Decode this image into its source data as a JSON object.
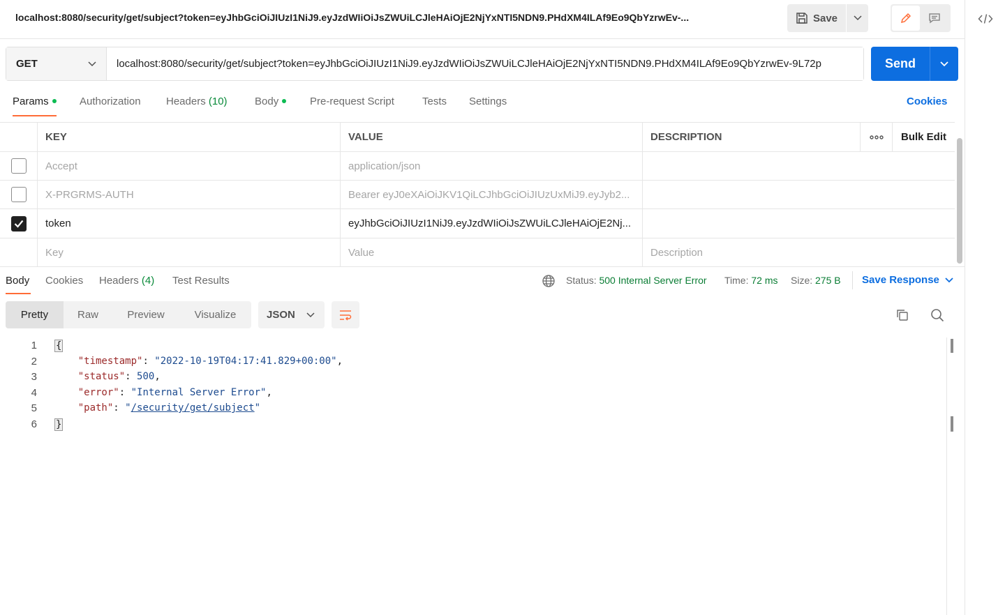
{
  "header": {
    "title": "localhost:8080/security/get/subject?token=eyJhbGciOiJIUzI1NiJ9.eyJzdWIiOiJsZWUiLCJleHAiOjE2NjYxNTI5NDN9.PHdXM4ILAf9Eo9QbYzrwEv-...",
    "save_label": "Save"
  },
  "request": {
    "method": "GET",
    "url": "localhost:8080/security/get/subject?token=eyJhbGciOiJIUzI1NiJ9.eyJzdWIiOiJsZWUiLCJleHAiOjE2NjYxNTI5NDN9.PHdXM4ILAf9Eo9QbYzrwEv-9L72p",
    "send_label": "Send"
  },
  "request_tabs": {
    "params": "Params",
    "authorization": "Authorization",
    "headers": "Headers",
    "headers_count": "(10)",
    "body": "Body",
    "prerequest": "Pre-request Script",
    "tests": "Tests",
    "settings": "Settings",
    "cookies": "Cookies"
  },
  "params_table": {
    "headers": {
      "key": "KEY",
      "value": "VALUE",
      "description": "DESCRIPTION",
      "bulk_edit": "Bulk Edit"
    },
    "rows": [
      {
        "checked": false,
        "key": "Accept",
        "value": "application/json",
        "description": ""
      },
      {
        "checked": false,
        "key": "X-PRGRMS-AUTH",
        "value": "Bearer eyJ0eXAiOiJKV1QiLCJhbGciOiJIUzUxMiJ9.eyJyb2...",
        "description": ""
      },
      {
        "checked": true,
        "key": "token",
        "value": "eyJhbGciOiJIUzI1NiJ9.eyJzdWIiOiJsZWUiLCJleHAiOjE2Nj...",
        "description": ""
      }
    ],
    "placeholder": {
      "key": "Key",
      "value": "Value",
      "description": "Description"
    }
  },
  "response_tabs": {
    "body": "Body",
    "cookies": "Cookies",
    "headers": "Headers",
    "headers_count": "(4)",
    "test_results": "Test Results"
  },
  "response_meta": {
    "status_label": "Status:",
    "status_value": "500 Internal Server Error",
    "time_label": "Time:",
    "time_value": "72 ms",
    "size_label": "Size:",
    "size_value": "275 B",
    "save_response": "Save Response"
  },
  "format_toolbar": {
    "tabs": [
      "Pretty",
      "Raw",
      "Preview",
      "Visualize"
    ],
    "active_tab": "Pretty",
    "language": "JSON"
  },
  "response_body": {
    "line_numbers": [
      "1",
      "2",
      "3",
      "4",
      "5",
      "6"
    ],
    "open_brace": "{",
    "close_brace": "}",
    "fields": [
      {
        "key": "\"timestamp\"",
        "value": "\"2022-10-19T04:17:41.829+00:00\"",
        "type": "string",
        "trail": ","
      },
      {
        "key": "\"status\"",
        "value": "500",
        "type": "number",
        "trail": ","
      },
      {
        "key": "\"error\"",
        "value": "\"Internal Server Error\"",
        "type": "string",
        "trail": ","
      },
      {
        "key": "\"path\"",
        "value": "/security/get/subject",
        "type": "link",
        "trail": ""
      }
    ]
  },
  "colors": {
    "accent_orange": "#ff6c37",
    "send_blue": "#0d6ee0",
    "status_green": "#0a7d34",
    "dot_green": "#0cbb52"
  }
}
